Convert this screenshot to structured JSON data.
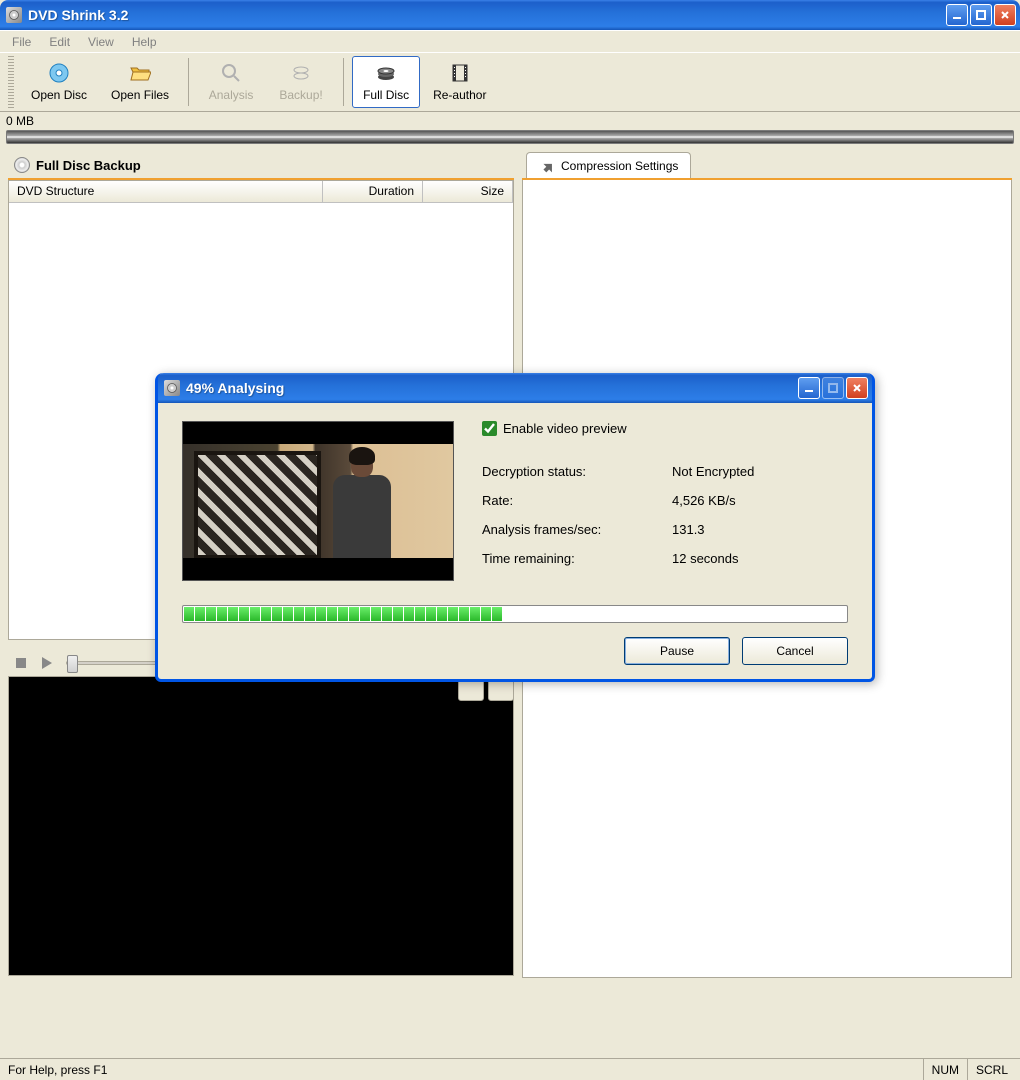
{
  "window": {
    "title": "DVD Shrink 3.2"
  },
  "menu": {
    "file": "File",
    "edit": "Edit",
    "view": "View",
    "help": "Help"
  },
  "toolbar": {
    "open_disc": "Open Disc",
    "open_files": "Open Files",
    "analysis": "Analysis",
    "backup": "Backup!",
    "full_disc": "Full Disc",
    "reauthor": "Re-author"
  },
  "sizebar": {
    "label": "0 MB"
  },
  "left_panel": {
    "title": "Full Disc Backup",
    "columns": {
      "structure": "DVD Structure",
      "duration": "Duration",
      "size": "Size"
    }
  },
  "right_panel": {
    "tab": "Compression Settings"
  },
  "status": {
    "help": "For Help, press F1",
    "num": "NUM",
    "scrl": "SCRL"
  },
  "dialog": {
    "title": "49% Analysing",
    "enable_preview": "Enable video preview",
    "rows": {
      "decryption_label": "Decryption status:",
      "decryption_value": "Not Encrypted",
      "rate_label": "Rate:",
      "rate_value": "4,526 KB/s",
      "frames_label": "Analysis frames/sec:",
      "frames_value": "131.3",
      "time_label": "Time remaining:",
      "time_value": "12 seconds"
    },
    "progress_percent": 49,
    "pause": "Pause",
    "cancel": "Cancel"
  }
}
